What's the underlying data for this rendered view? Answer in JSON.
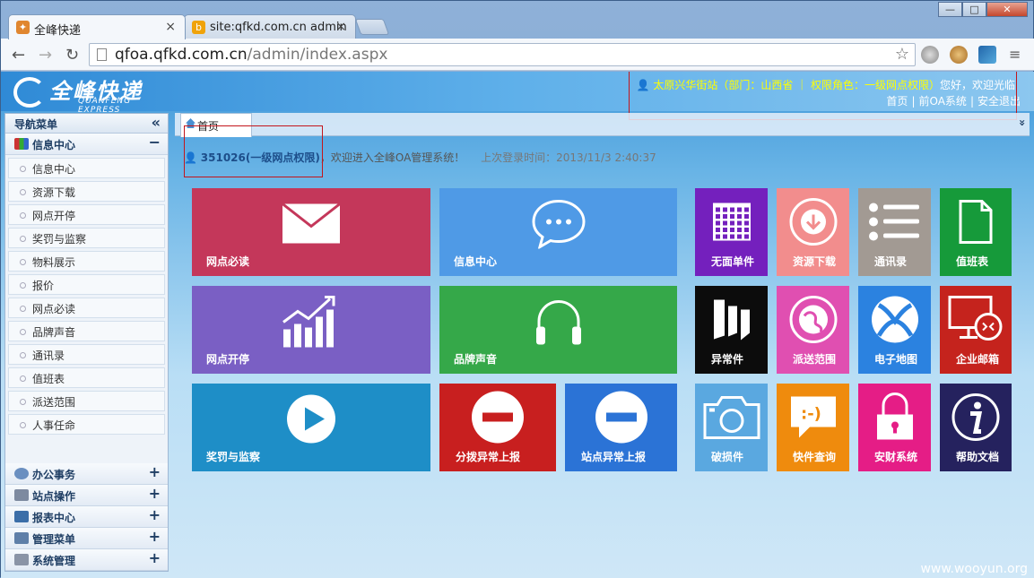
{
  "browser": {
    "tabs": [
      {
        "title": "全峰快递",
        "close": "×"
      },
      {
        "title": "site:qfkd.com.cn admin",
        "close": "×"
      }
    ],
    "window_buttons": [
      "—",
      "□",
      "✕"
    ],
    "url_host": "qfoa.qfkd.com.cn",
    "url_path": "/admin/index.aspx"
  },
  "header": {
    "logo_cn": "全峰快递",
    "logo_en": "QUANFENG EXPRESS",
    "user_info": "太原兴华街站（部门：山西省 ｜ 权限角色：一级网点权限）",
    "user_greeting": "您好，欢迎光临",
    "links": [
      "首页",
      "前OA系统",
      "安全退出"
    ]
  },
  "sidebar": {
    "title": "导航菜单",
    "collapse": "«",
    "open_section": {
      "label": "信息中心",
      "toggle": "−"
    },
    "items": [
      "信息中心",
      "资源下载",
      "网点开停",
      "奖罚与监察",
      "物料展示",
      "报价",
      "网点必读",
      "品牌声音",
      "通讯录",
      "值班表",
      "派送范围",
      "人事任命"
    ],
    "sections": [
      {
        "label": "办公事务",
        "toggle": "+"
      },
      {
        "label": "站点操作",
        "toggle": "+"
      },
      {
        "label": "报表中心",
        "toggle": "+"
      },
      {
        "label": "管理菜单",
        "toggle": "+"
      },
      {
        "label": "系统管理",
        "toggle": "+"
      }
    ]
  },
  "content": {
    "tab": "首页",
    "tab_right": "»",
    "welcome_id": "351026(一级网点权限)",
    "welcome_text": "，欢迎进入全峰OA管理系统！",
    "last_login": "上次登录时间：2013/11/3 2:40:37"
  },
  "tiles": [
    {
      "label": "网点必读",
      "color": "#c4375a",
      "icon": "envelope-icon"
    },
    {
      "label": "信息中心",
      "color": "#4f9ae6",
      "icon": "chat-bubble-icon"
    },
    {
      "label": "无面单件",
      "color": "#7420bd",
      "icon": "calendar-icon"
    },
    {
      "label": "资源下载",
      "color": "#f28d8d",
      "icon": "download-icon"
    },
    {
      "label": "通讯录",
      "color": "#a29a93",
      "icon": "list-icon"
    },
    {
      "label": "值班表",
      "color": "#169a3a",
      "icon": "document-icon"
    },
    {
      "label": "网点开停",
      "color": "#7a5fc4",
      "icon": "chart-icon"
    },
    {
      "label": "品牌声音",
      "color": "#35a849",
      "icon": "headphones-icon"
    },
    {
      "label": "异常件",
      "color": "#0c0c0c",
      "icon": "book-icon"
    },
    {
      "label": "派送范围",
      "color": "#e04fb1",
      "icon": "globe-icon"
    },
    {
      "label": "电子地图",
      "color": "#2b82e0",
      "icon": "xbox-icon"
    },
    {
      "label": "企业邮箱",
      "color": "#c5231d",
      "icon": "remote-icon"
    },
    {
      "label": "奖罚与监察",
      "color": "#1e8ec7",
      "icon": "play-icon"
    },
    {
      "label": "分拨异常上报",
      "color": "#c81f1f",
      "icon": "minus-icon"
    },
    {
      "label": "站点异常上报",
      "color": "#2b73d6",
      "icon": "minus-icon"
    },
    {
      "label": "破损件",
      "color": "#5aa8e0",
      "icon": "camera-icon"
    },
    {
      "label": "快件查询",
      "color": "#ef8b0d",
      "icon": "emoticon-icon"
    },
    {
      "label": "安财系统",
      "color": "#e51d86",
      "icon": "lock-icon"
    },
    {
      "label": "帮助文档",
      "color": "#25225e",
      "icon": "info-icon"
    }
  ],
  "watermark": "www.wooyun.org"
}
